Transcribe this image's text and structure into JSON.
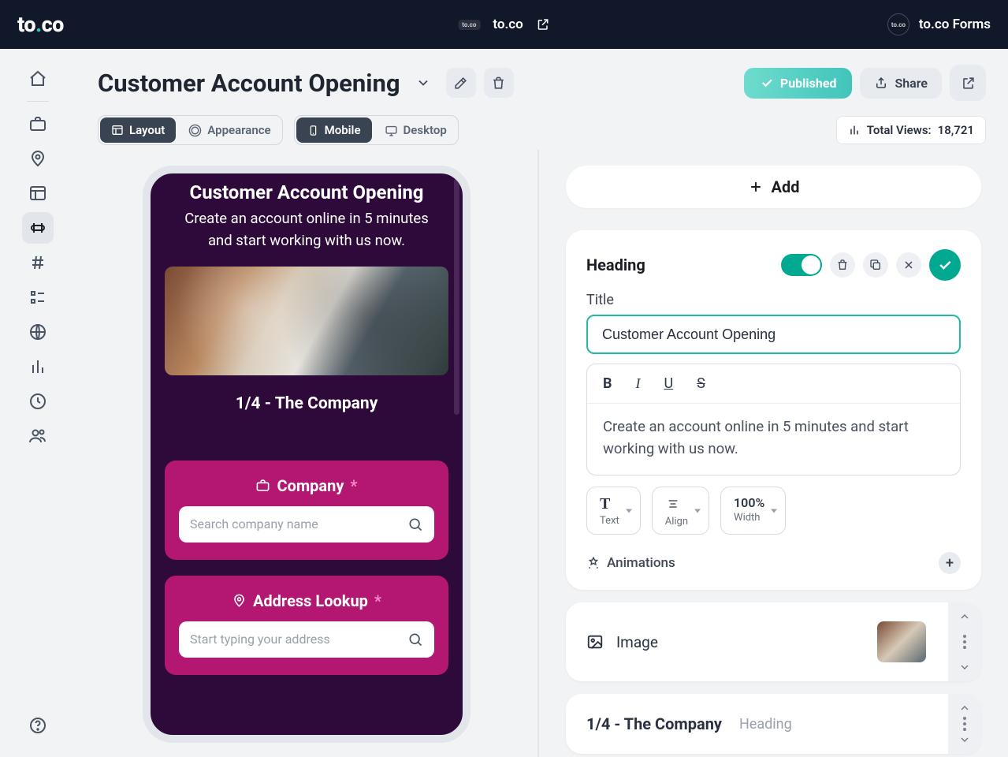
{
  "topbar": {
    "brand_prefix": "to",
    "brand_suffix": "co",
    "product": "to.co",
    "right_label": "to.co Forms"
  },
  "header": {
    "title": "Customer Account Opening",
    "publish": "Published",
    "share": "Share",
    "views_label": "Total Views:",
    "views_value": "18,721"
  },
  "segments": {
    "layout": "Layout",
    "appearance": "Appearance",
    "mobile": "Mobile",
    "desktop": "Desktop"
  },
  "preview": {
    "title": "Customer Account Opening",
    "subtitle": "Create an account online in 5 minutes and start working with us now.",
    "step": "1/4 - The Company",
    "company_label": "Company",
    "company_placeholder": "Search company name",
    "address_label": "Address Lookup",
    "address_placeholder": "Start typing your address"
  },
  "right": {
    "add": "Add",
    "heading_panel": "Heading",
    "title_label": "Title",
    "title_value": "Customer Account Opening",
    "body_value": "Create an account online in 5 minutes and start working with us now.",
    "prop_text": "Text",
    "prop_align": "Align",
    "prop_width_val": "100%",
    "prop_width": "Width",
    "animations": "Animations",
    "image_row": "Image",
    "sec2_title": "1/4 - The Company",
    "sec2_type": "Heading"
  }
}
